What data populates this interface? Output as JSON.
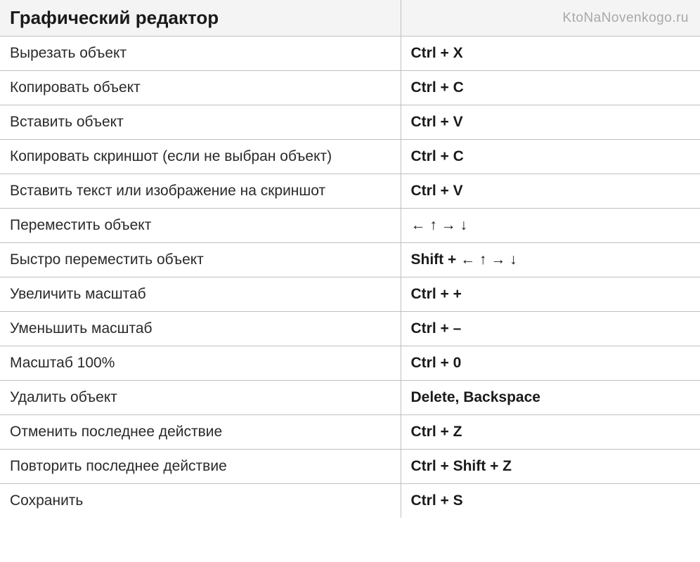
{
  "header": {
    "title": "Графический редактор",
    "watermark": "KtoNaNovenkogo.ru"
  },
  "rows": [
    {
      "action": "Вырезать объект",
      "shortcut": "Ctrl + X"
    },
    {
      "action": "Копировать объект",
      "shortcut": "Ctrl + C"
    },
    {
      "action": "Вставить объект",
      "shortcut": "Ctrl + V"
    },
    {
      "action": "Копировать скриншот (если не выбран объект)",
      "shortcut": "Ctrl + C"
    },
    {
      "action": "Вставить текст или изображение на скриншот",
      "shortcut": "Ctrl + V"
    },
    {
      "action": "Переместить объект",
      "shortcut": "← ↑ → ↓"
    },
    {
      "action": "Быстро переместить объект",
      "shortcut": "Shift + ← ↑ → ↓"
    },
    {
      "action": "Увеличить масштаб",
      "shortcut": "Ctrl + +"
    },
    {
      "action": "Уменьшить масштаб",
      "shortcut": "Ctrl + –"
    },
    {
      "action": "Масштаб 100%",
      "shortcut": "Ctrl + 0"
    },
    {
      "action": "Удалить объект",
      "shortcut": "Delete, Backspace"
    },
    {
      "action": "Отменить последнее действие",
      "shortcut": "Ctrl + Z"
    },
    {
      "action": "Повторить последнее действие",
      "shortcut": "Ctrl + Shift + Z"
    },
    {
      "action": "Сохранить",
      "shortcut": "Ctrl + S"
    }
  ]
}
